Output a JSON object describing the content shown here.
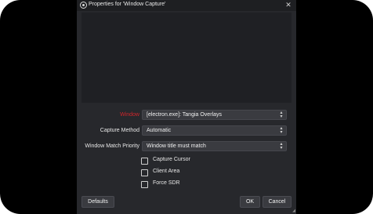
{
  "window": {
    "title": "Properties for 'Window Capture'"
  },
  "form": {
    "window_label": "Window",
    "window_value": "[electron.exe]: Tangia Overlays",
    "capture_method_label": "Capture Method",
    "capture_method_value": "Automatic",
    "match_priority_label": "Window Match Priority",
    "match_priority_value": "Window title must match",
    "checkboxes": [
      {
        "label": "Capture Cursor",
        "checked": false
      },
      {
        "label": "Client Area",
        "checked": false
      },
      {
        "label": "Force SDR",
        "checked": false
      }
    ]
  },
  "buttons": {
    "defaults": "Defaults",
    "ok": "OK",
    "cancel": "Cancel"
  },
  "icons": {
    "app": "obs-logo-icon",
    "close": "close-icon",
    "combo_arrow": "updown-chevron-icon",
    "resize": "resize-grip-icon"
  },
  "colors": {
    "dialog_bg": "#27282c",
    "field_bg": "#3a3b40",
    "warning_label": "#d0252b"
  }
}
